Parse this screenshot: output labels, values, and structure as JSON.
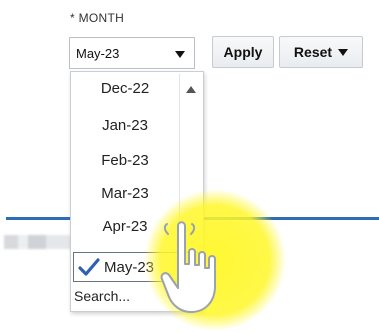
{
  "filter": {
    "label": "* MONTH",
    "selected_value": "May-23"
  },
  "buttons": {
    "apply_label": "Apply",
    "reset_label": "Reset"
  },
  "dropdown": {
    "options": [
      "Dec-22",
      "Jan-23",
      "Feb-23",
      "Mar-23",
      "Apr-23"
    ],
    "selected_option": "May-23",
    "search_label": "Search..."
  },
  "colors": {
    "accent_rule": "#2d6db5",
    "check": "#2f5fb3",
    "cursor_highlight": "#fff728"
  },
  "icons": [
    "dropdown-caret-icon",
    "scroll-up-icon",
    "checkmark-icon",
    "hand-pointer-icon"
  ]
}
